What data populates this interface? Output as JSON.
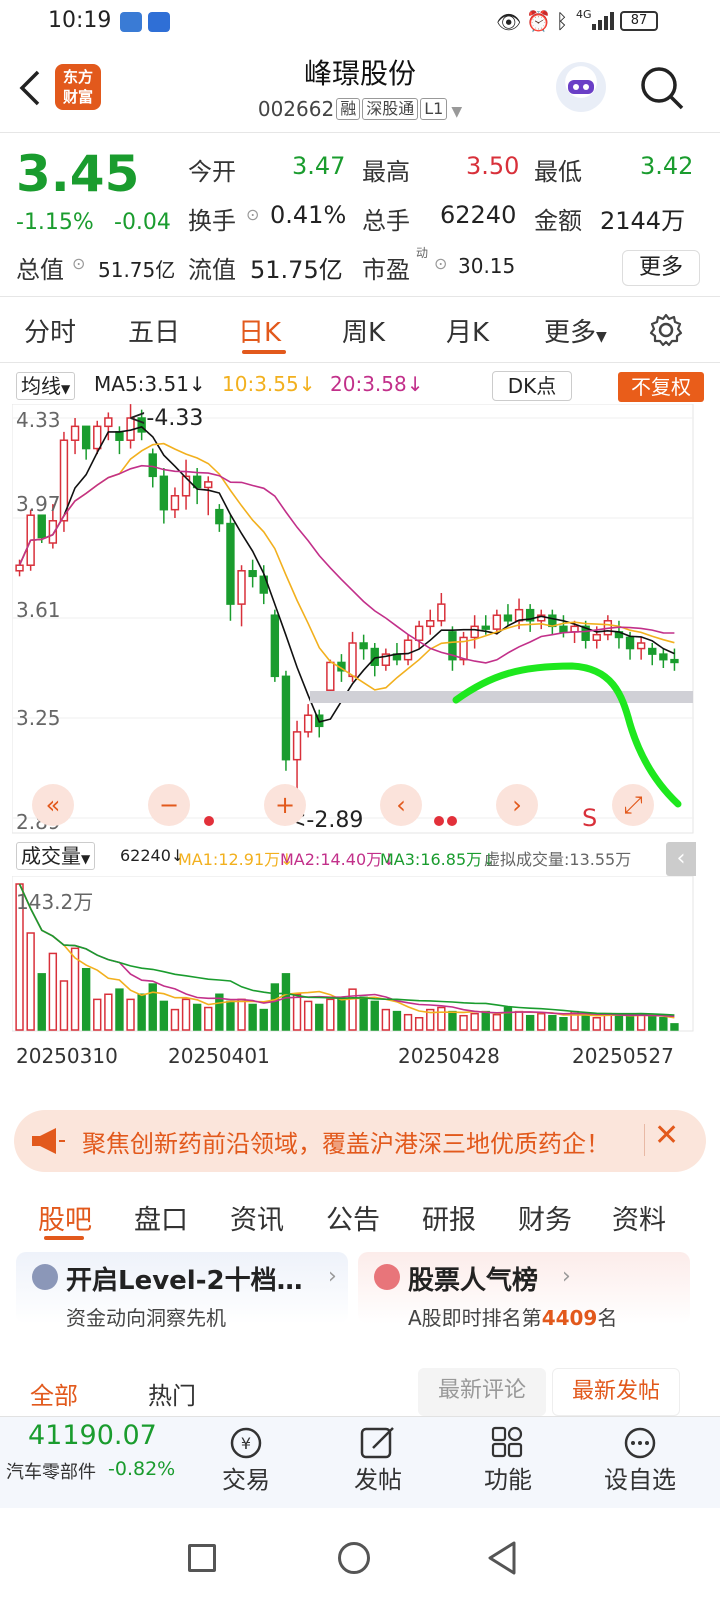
{
  "status": {
    "time": "10:19",
    "net": "4G",
    "battery": "87"
  },
  "header": {
    "title": "峰璟股份",
    "code": "002662",
    "tags": [
      "融",
      "深股通",
      "L1"
    ],
    "logo": "东方\n财富"
  },
  "quote": {
    "price": "3.45",
    "change_pct": "-1.15%",
    "change": "-0.04",
    "open_label": "今开",
    "open": "3.47",
    "high_label": "最高",
    "high": "3.50",
    "low_label": "最低",
    "low": "3.42",
    "turnover_label": "换手",
    "turnover": "0.41%",
    "volume_label": "总手",
    "volume": "62240",
    "amount_label": "金额",
    "amount": "2144万",
    "mcap_label": "总值",
    "mcap": "51.75亿",
    "float_label": "流值",
    "float": "51.75亿",
    "pe_label": "市盈",
    "pe_sup": "动",
    "pe": "30.15",
    "more": "更多"
  },
  "tabs": [
    "分时",
    "五日",
    "日K",
    "周K",
    "月K",
    "更多"
  ],
  "chart_bar": {
    "ma_select": "均线",
    "ma5": "MA5:3.51↓",
    "ma10": "10:3.55↓",
    "ma20": "20:3.58↓",
    "dk": "DK点",
    "fq": "不复权"
  },
  "chart_data": {
    "type": "candlestick",
    "y_ticks": [
      "4.33",
      "3.97",
      "3.61",
      "3.25",
      "2.89"
    ],
    "ylim": [
      2.89,
      4.33
    ],
    "max_label": "<-4.33",
    "min_label": "<-2.89",
    "x_labels": [
      "20250310",
      "20250401",
      "20250428",
      "20250527"
    ],
    "candles": [
      [
        3.78,
        3.82,
        3.76,
        3.8
      ],
      [
        3.8,
        4.0,
        3.78,
        3.98
      ],
      [
        3.98,
        3.95,
        3.88,
        3.9
      ],
      [
        3.88,
        4.02,
        3.86,
        3.96
      ],
      [
        3.96,
        4.28,
        3.92,
        4.25
      ],
      [
        4.25,
        4.33,
        4.2,
        4.3
      ],
      [
        4.3,
        4.28,
        4.18,
        4.22
      ],
      [
        4.22,
        4.32,
        4.2,
        4.3
      ],
      [
        4.3,
        4.35,
        4.25,
        4.33
      ],
      [
        4.28,
        4.3,
        4.2,
        4.25
      ],
      [
        4.25,
        4.38,
        4.22,
        4.33
      ],
      [
        4.33,
        4.36,
        4.25,
        4.28
      ],
      [
        4.2,
        4.22,
        4.08,
        4.12
      ],
      [
        4.12,
        4.15,
        3.95,
        4.0
      ],
      [
        4.0,
        4.08,
        3.97,
        4.05
      ],
      [
        4.05,
        4.18,
        4.0,
        4.12
      ],
      [
        4.12,
        4.15,
        4.02,
        4.08
      ],
      [
        4.08,
        4.12,
        3.98,
        4.1
      ],
      [
        4.0,
        4.02,
        3.92,
        3.95
      ],
      [
        3.95,
        3.98,
        3.6,
        3.66
      ],
      [
        3.66,
        3.8,
        3.58,
        3.78
      ],
      [
        3.78,
        3.82,
        3.72,
        3.76
      ],
      [
        3.76,
        3.8,
        3.66,
        3.7
      ],
      [
        3.62,
        3.64,
        3.38,
        3.4
      ],
      [
        3.4,
        3.42,
        3.06,
        3.1
      ],
      [
        3.1,
        3.24,
        2.89,
        3.2
      ],
      [
        3.2,
        3.3,
        3.18,
        3.26
      ],
      [
        3.26,
        3.28,
        3.18,
        3.22
      ],
      [
        3.35,
        3.46,
        3.33,
        3.45
      ],
      [
        3.45,
        3.48,
        3.38,
        3.42
      ],
      [
        3.4,
        3.56,
        3.38,
        3.52
      ],
      [
        3.52,
        3.55,
        3.46,
        3.5
      ],
      [
        3.5,
        3.52,
        3.4,
        3.44
      ],
      [
        3.44,
        3.5,
        3.42,
        3.48
      ],
      [
        3.48,
        3.52,
        3.44,
        3.46
      ],
      [
        3.46,
        3.55,
        3.44,
        3.53
      ],
      [
        3.53,
        3.6,
        3.5,
        3.58
      ],
      [
        3.58,
        3.64,
        3.55,
        3.6
      ],
      [
        3.6,
        3.7,
        3.58,
        3.66
      ],
      [
        3.56,
        3.58,
        3.42,
        3.46
      ],
      [
        3.46,
        3.56,
        3.44,
        3.54
      ],
      [
        3.54,
        3.62,
        3.5,
        3.58
      ],
      [
        3.58,
        3.62,
        3.55,
        3.57
      ],
      [
        3.57,
        3.64,
        3.55,
        3.62
      ],
      [
        3.62,
        3.66,
        3.58,
        3.6
      ],
      [
        3.6,
        3.68,
        3.57,
        3.64
      ],
      [
        3.64,
        3.66,
        3.56,
        3.6
      ],
      [
        3.6,
        3.64,
        3.57,
        3.62
      ],
      [
        3.62,
        3.64,
        3.55,
        3.58
      ],
      [
        3.58,
        3.62,
        3.54,
        3.56
      ],
      [
        3.56,
        3.6,
        3.52,
        3.58
      ],
      [
        3.58,
        3.6,
        3.5,
        3.53
      ],
      [
        3.53,
        3.58,
        3.5,
        3.55
      ],
      [
        3.55,
        3.62,
        3.53,
        3.6
      ],
      [
        3.56,
        3.6,
        3.5,
        3.54
      ],
      [
        3.54,
        3.56,
        3.46,
        3.5
      ],
      [
        3.5,
        3.54,
        3.46,
        3.52
      ],
      [
        3.5,
        3.52,
        3.44,
        3.48
      ],
      [
        3.48,
        3.5,
        3.43,
        3.46
      ],
      [
        3.46,
        3.5,
        3.42,
        3.45
      ]
    ],
    "volume_bar": {
      "select": "成交量",
      "vol": "62240↓",
      "ma1": "MA1:12.91万↓",
      "ma2": "MA2:14.40万↓",
      "ma3": "MA3:16.85万↓",
      "virtual": "虚拟成交量:13.55万",
      "max_label": "143.2万"
    },
    "volumes": [
      143,
      95,
      55,
      75,
      48,
      80,
      60,
      30,
      35,
      40,
      30,
      35,
      45,
      28,
      20,
      30,
      25,
      22,
      35,
      28,
      30,
      25,
      20,
      45,
      55,
      35,
      28,
      25,
      30,
      30,
      40,
      32,
      28,
      20,
      18,
      15,
      12,
      20,
      22,
      18,
      14,
      16,
      18,
      15,
      22,
      18,
      14,
      16,
      14,
      12,
      18,
      14,
      12,
      16,
      14,
      14,
      15,
      13,
      12,
      6
    ]
  },
  "chart_controls": {
    "s_label": "S"
  },
  "banner": {
    "text": "聚焦创新药前沿领域，覆盖沪港深三地优质药企！"
  },
  "tabs2": [
    "股吧",
    "盘口",
    "资讯",
    "公告",
    "研报",
    "财务",
    "资料"
  ],
  "cards": [
    {
      "title": "开启Level-2十档…",
      "sub": "资金动向洞察先机"
    },
    {
      "title": "股票人气榜",
      "sub_pre": "A股即时排名第",
      "rank": "4409",
      "sub_post": "名"
    }
  ],
  "filters": {
    "all": "全部",
    "hot": "热门",
    "latest_comment": "最新评论",
    "latest_post": "最新发帖"
  },
  "bottom": {
    "index_value": "41190.07",
    "index_name": "汽车零部件",
    "index_change": "-0.82%",
    "trade": "交易",
    "post": "发帖",
    "func": "功能",
    "fav": "设自选"
  }
}
